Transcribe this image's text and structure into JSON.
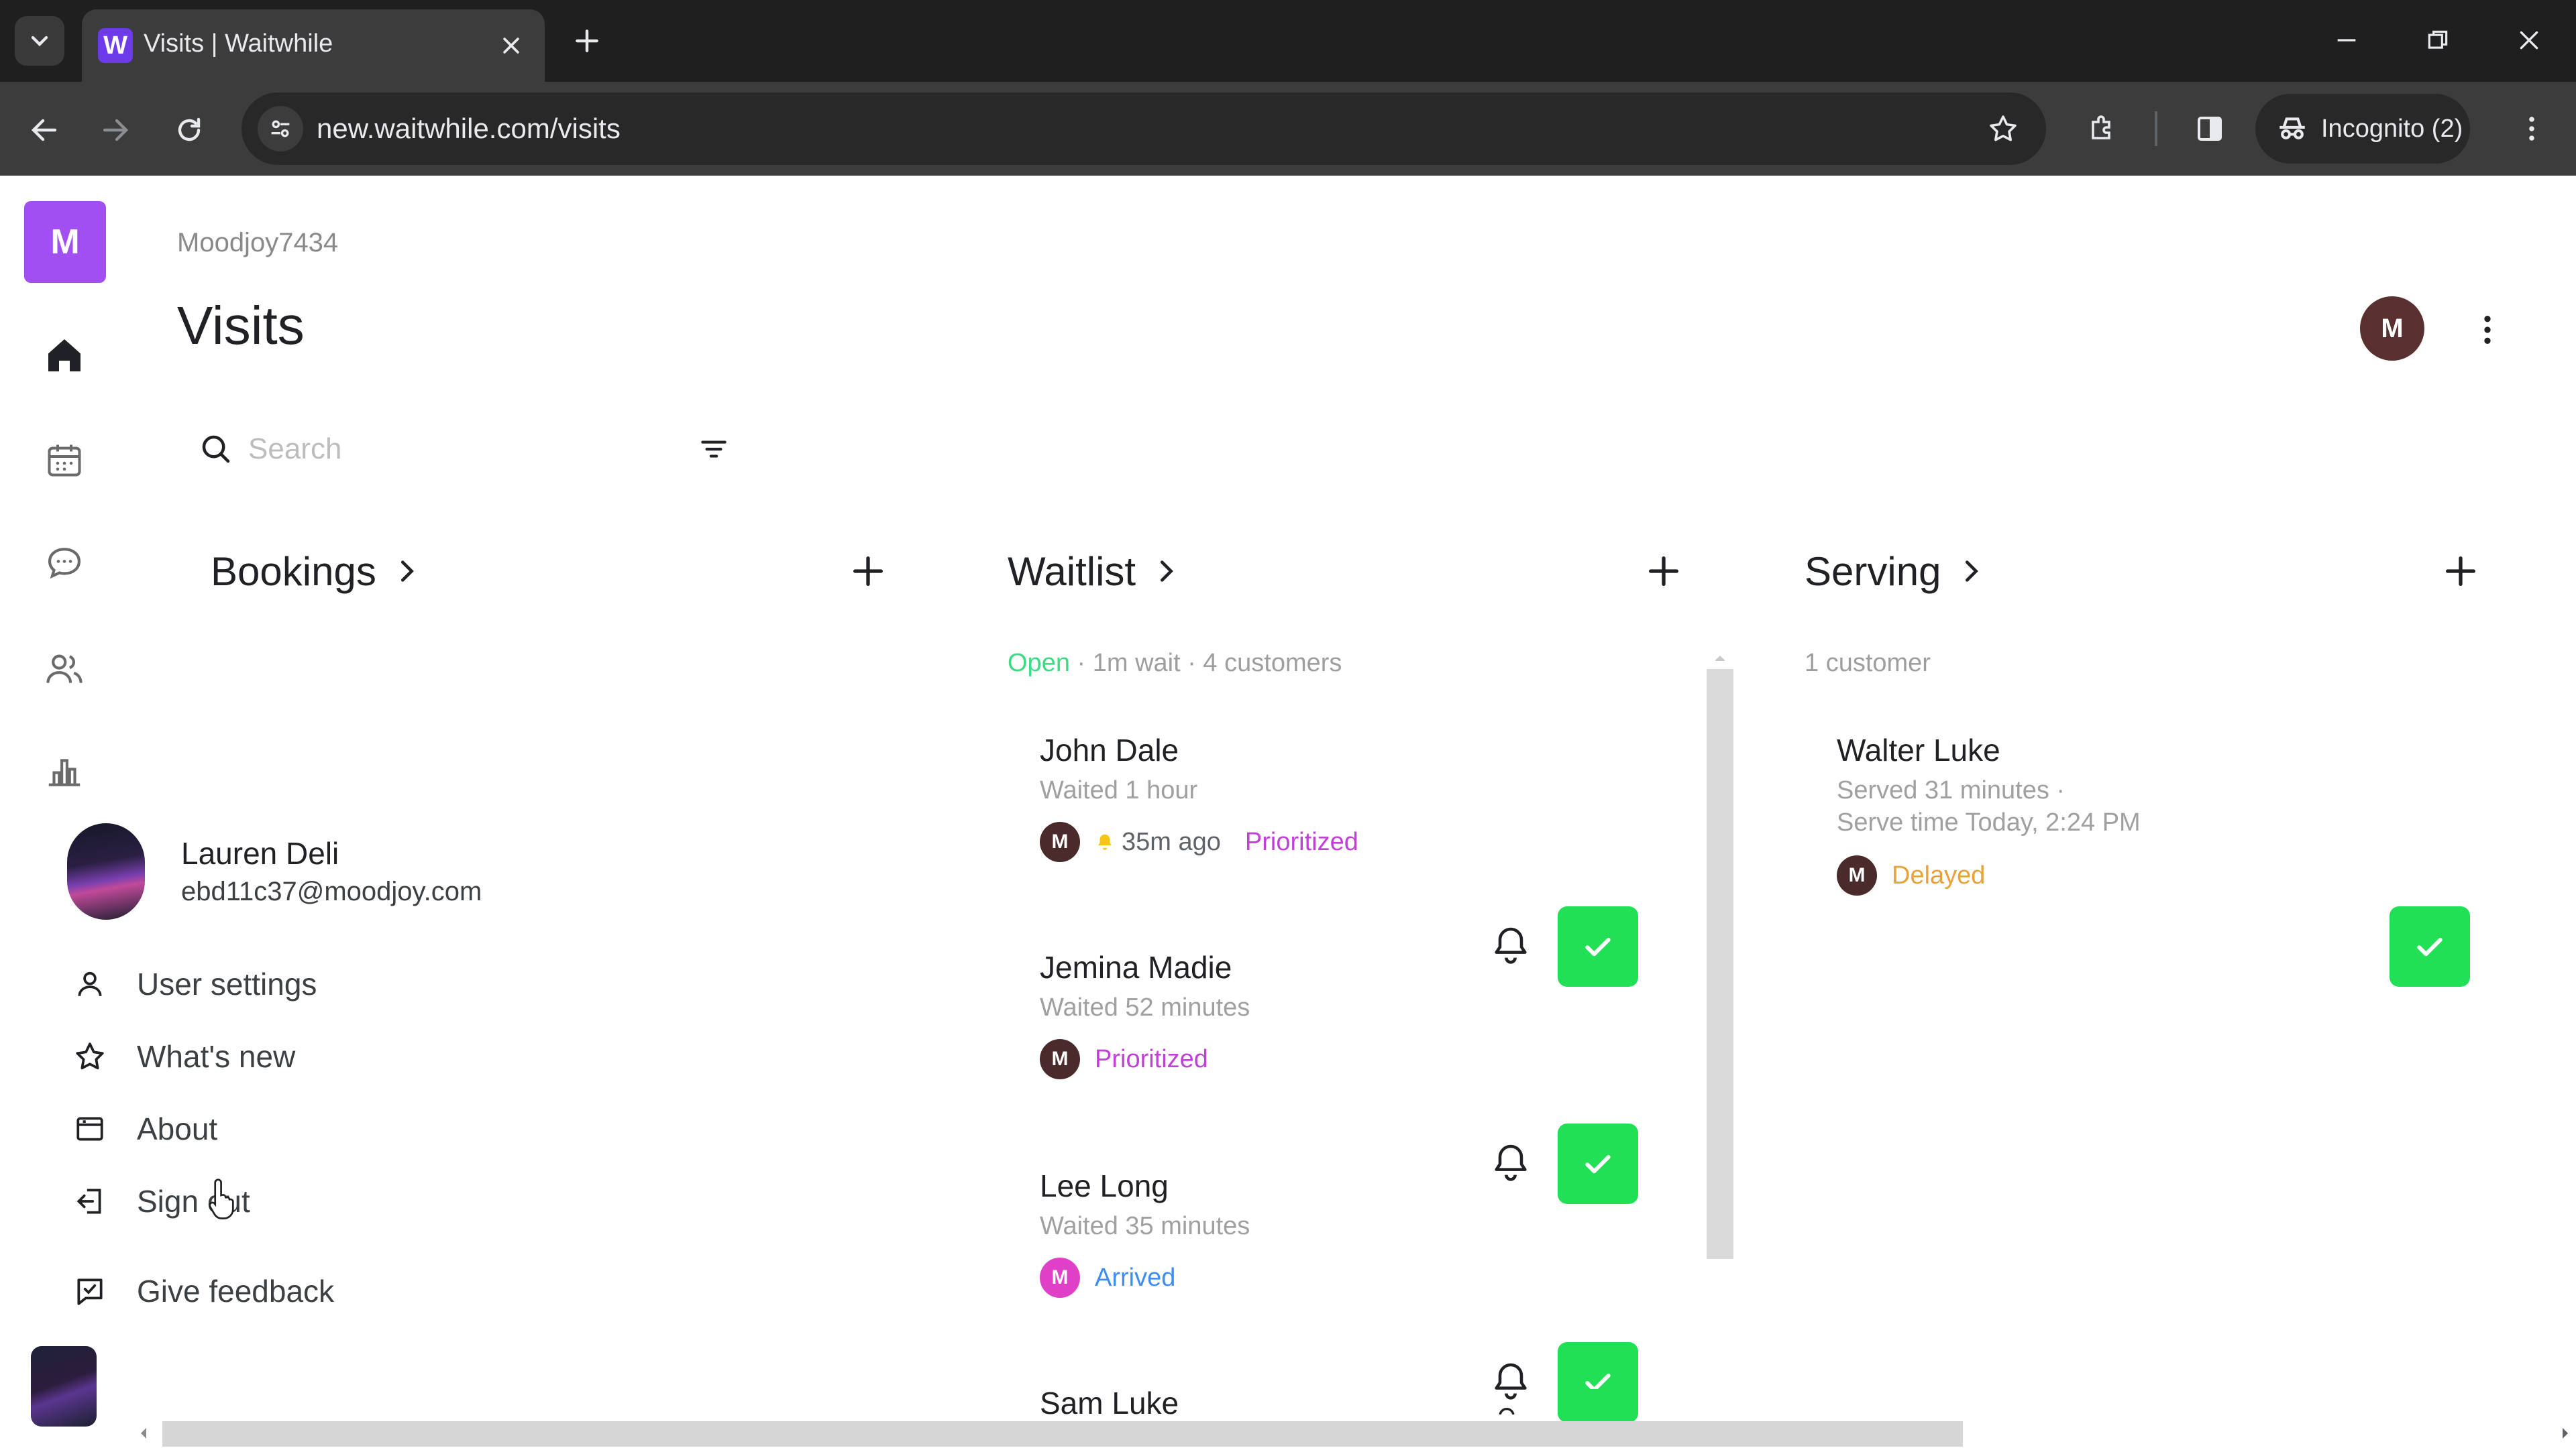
{
  "browser": {
    "tab_title": "Visits | Waitwhile",
    "url": "new.waitwhile.com/visits",
    "incognito_label": "Incognito (2)"
  },
  "rail": {
    "logo_letter": "M",
    "items": [
      "home-icon",
      "calendar-icon",
      "chat-icon",
      "people-icon",
      "analytics-icon"
    ]
  },
  "header": {
    "org_name": "Moodjoy7434",
    "title": "Visits",
    "avatar_letter": "M"
  },
  "search": {
    "placeholder": "Search",
    "value": ""
  },
  "columns": {
    "bookings": {
      "title": "Bookings"
    },
    "waitlist": {
      "title": "Waitlist",
      "status_open": "Open",
      "status_rest": " · 1m wait · 4 customers",
      "cards": [
        {
          "name": "John Dale",
          "waited": "Waited 1 hour",
          "avatar": "M",
          "ago": "35m ago",
          "tag": "Prioritized"
        },
        {
          "name": "Jemina Madie",
          "waited": "Waited 52 minutes",
          "avatar": "M",
          "tag": "Prioritized"
        },
        {
          "name": "Lee Long",
          "waited": "Waited 35 minutes",
          "avatar": "M",
          "tag": "Arrived"
        },
        {
          "name": "Sam Luke"
        }
      ]
    },
    "serving": {
      "title": "Serving",
      "meta": "1 customer",
      "cards": [
        {
          "name": "Walter Luke",
          "served": "Served 31 minutes ·",
          "serve_time": "Serve time Today, 2:24 PM",
          "avatar": "M",
          "tag": "Delayed"
        }
      ]
    }
  },
  "user_menu": {
    "name": "Lauren Deli",
    "email": "ebd11c37@moodjoy.com",
    "items": [
      {
        "label": "User settings",
        "icon": "person-icon"
      },
      {
        "label": "What's new",
        "icon": "star-icon"
      },
      {
        "label": "About",
        "icon": "window-icon"
      },
      {
        "label": "Sign out",
        "icon": "sign-out-icon"
      },
      {
        "label": "Give feedback",
        "icon": "feedback-icon"
      }
    ]
  },
  "colors": {
    "accent_purple": "#a14ff0",
    "check_green": "#22e055",
    "prioritized": "#c140d8",
    "arrived": "#3d8ef0",
    "delayed": "#e8a23a",
    "open_green": "#3ddc84"
  }
}
